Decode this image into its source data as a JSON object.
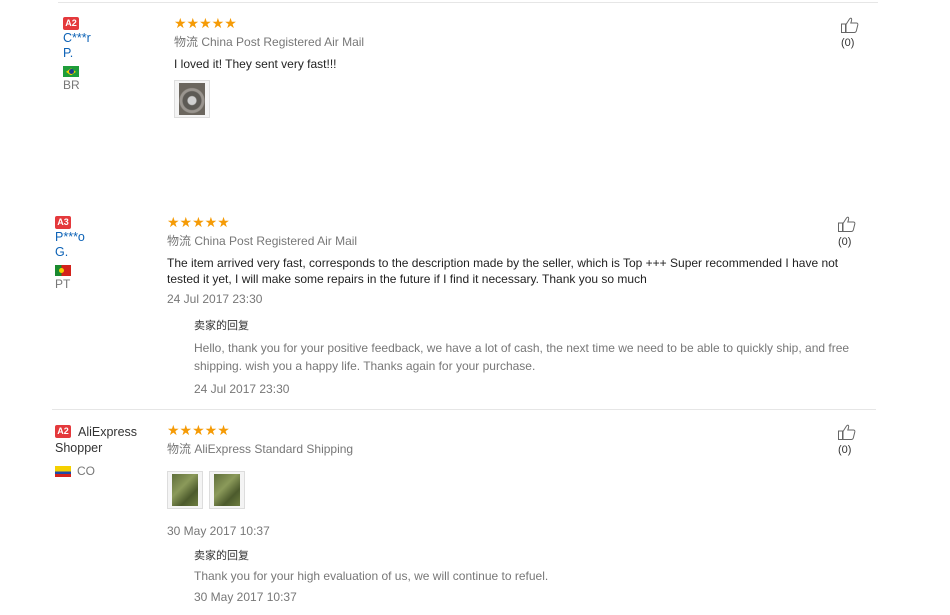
{
  "reviews": [
    {
      "level": "A2",
      "user": "C***r P.",
      "country": "BR",
      "stars": "★★★★★",
      "shipping": "物流 China Post Registered Air Mail",
      "text": "I loved it! They sent very fast!!!",
      "helpful": "(0)",
      "photos": [
        "ring-photo"
      ]
    },
    {
      "level": "A3",
      "user": "P***o G.",
      "country": "PT",
      "stars": "★★★★★",
      "shipping": "物流 China Post Registered Air Mail",
      "text_line1": "The item arrived very fast, corresponds to the description made by the seller, which is Top +++ Super recommended I have not",
      "text_line2": "tested it yet, I will make some repairs in the future if I find it necessary. Thank you so much",
      "date": "24 Jul 2017 23:30",
      "reply_title": "卖家的回复",
      "reply_line1": "Hello, thank you for your positive feedback, we have a lot of cash, the next time we need to be able to quickly ship, and free",
      "reply_line2": "shipping. wish you a happy life. Thanks again for your purchase.",
      "reply_date": "24 Jul 2017 23:30",
      "helpful": "(0)"
    },
    {
      "level": "A2",
      "user_line1": "AliExpress",
      "user_line2": "Shopper",
      "country": "CO",
      "stars": "★★★★★",
      "shipping": "物流 AliExpress Standard Shipping",
      "date": "30 May 2017 10:37",
      "reply_title": "卖家的回复",
      "reply_text": "Thank you for your high evaluation of us, we will continue to refuel.",
      "reply_date": "30 May 2017 10:37",
      "helpful": "(0)",
      "photos": [
        "case-photo-1",
        "case-photo-2"
      ]
    }
  ],
  "colors": {
    "star": "#f59b06",
    "level_badge": "#e4393c",
    "username": "#0c62b6",
    "muted_text": "#777777"
  }
}
